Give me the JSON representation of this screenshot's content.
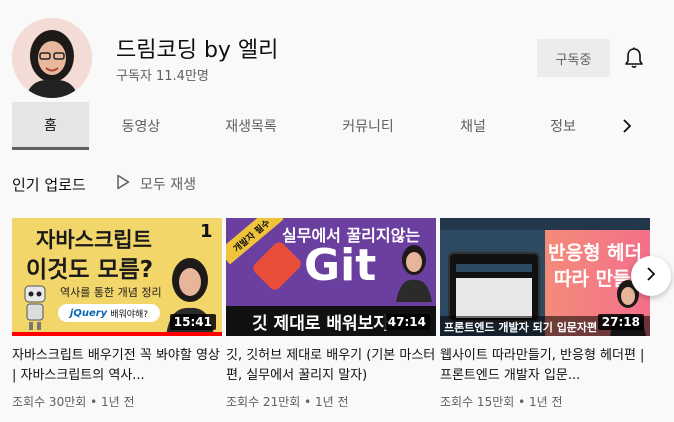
{
  "channel": {
    "name": "드림코딩 by 엘리",
    "subscribers": "구독자 11.4만명",
    "subscribe_label": "구독중"
  },
  "tabs": [
    {
      "label": "홈",
      "active": true
    },
    {
      "label": "동영상"
    },
    {
      "label": "재생목록"
    },
    {
      "label": "커뮤니티"
    },
    {
      "label": "채널"
    },
    {
      "label": "정보"
    }
  ],
  "section": {
    "title": "인기 업로드",
    "play_all": "모두 재생"
  },
  "videos": [
    {
      "title": "자바스크립트 배우기전 꼭 봐야할 영상 | 자바스크립트의 역사...",
      "meta": "조회수 30만회 • 1년 전",
      "duration": "15:41",
      "watched": 1.0,
      "thumb": {
        "line1": "자바스크립트",
        "line2": "이것도 모름?",
        "sub": "역사를 통한 개념 정리",
        "number": "1",
        "badge": "jQuery",
        "badge_suffix": "배워야해?"
      }
    },
    {
      "title": "깃, 깃허브 제대로 배우기 (기본 마스터편, 실무에서 꿀리지 말자)",
      "meta": "조회수 21만회 • 1년 전",
      "duration": "47:14",
      "thumb": {
        "ribbon": "개발자 필수",
        "line1": "실무에서 꿀리지않는",
        "big": "Git",
        "line2": "깃 제대로 배워보자"
      }
    },
    {
      "title": "웹사이트 따라만들기, 반응형 헤더편 | 프론트엔드 개발자 입문...",
      "meta": "조회수 15만회 • 1년 전",
      "duration": "27:18",
      "thumb": {
        "line1": "반응형 헤더",
        "line2": "따라 만들기",
        "bottom": "프론트엔드 개발자 되기 입문자편"
      }
    }
  ],
  "colors": {
    "background": "#f9f9f9",
    "text_primary": "#0f0f0f",
    "text_secondary": "#606060",
    "progress": "#ff0000",
    "git_purple": "#6b3fa0",
    "web_pink": "#f06a6a"
  },
  "icons": {
    "bell": "bell-icon",
    "play_all": "play-icon",
    "tabs_next": "chevron-right-icon",
    "carousel_next": "chevron-right-icon"
  }
}
